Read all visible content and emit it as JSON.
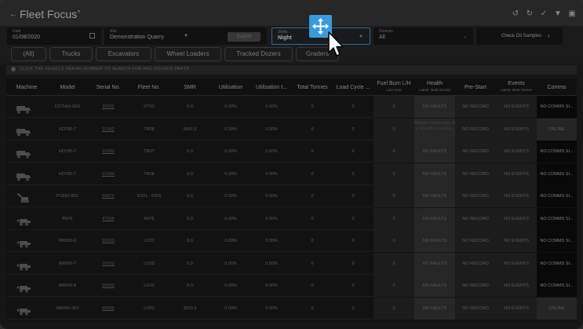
{
  "header": {
    "title": "Fleet Focus"
  },
  "filters": {
    "date": {
      "label": "Date",
      "value": "01/08/2020"
    },
    "site": {
      "label": "Site",
      "value": "Demonstration Quarry"
    },
    "submit_label": "Submit",
    "shifts": {
      "label": "Shifts",
      "value": "Night"
    },
    "devices": {
      "label": "Devices",
      "value": "All"
    },
    "oil_label": "Check Oil Samples"
  },
  "tabs": [
    "(All)",
    "Trucks",
    "Excavators",
    "Wheel Loaders",
    "Tracked Dozers",
    "Graders"
  ],
  "info_text": "CLICK THE VEHICLE SERIAL NUMBER TO SEARCH FOR AND SOURCE PARTS",
  "columns": {
    "machine": "Machine",
    "model": "Model",
    "serial": "Serial No.",
    "fleet": "Fleet No.",
    "smr": "SMR",
    "util": "Utilisation",
    "util_t": "Utilisation t...",
    "tonnes": "Total Tonnes",
    "load": "Load Cycle ...",
    "fuel": "Fuel Burn L/H",
    "fuel_sub": "Last Hour",
    "health": "Health",
    "health_sub": "Latest, Most Severe",
    "prestart": "Pre-Start",
    "events": "Events",
    "events_sub": "Latest, Most Severe",
    "comms": "Comms"
  },
  "rows": [
    {
      "icon": "truck-icon",
      "model": "D275AX-5E0",
      "serial": "32302",
      "fleet": "DT01",
      "smr": "0.0",
      "util": "0.00%",
      "util_t": "0.00%",
      "tonnes": "0",
      "load": "0",
      "fuel": "0",
      "health": "NO FAULTS",
      "prestart": "NO RECORD",
      "events": "NO EVENTS",
      "comms": "NO COMMS SI..."
    },
    {
      "icon": "truck-icon",
      "model": "HD785-7",
      "serial": "32382",
      "fleet": "TR06",
      "smr": "9041.5",
      "util": "0.00%",
      "util_t": "0.00%",
      "tonnes": "0",
      "load": "0",
      "fuel": "0",
      "health": "Altitude Overrange of a Specific Load lvl...",
      "prestart": "NO RECORD",
      "events": "NO EVENTS",
      "comms": "ONLINE"
    },
    {
      "icon": "truck-icon",
      "model": "HD785-7",
      "serial": "32382",
      "fleet": "TR07",
      "smr": "0.0",
      "util": "0.00%",
      "util_t": "0.00%",
      "tonnes": "0",
      "load": "0",
      "fuel": "0",
      "health": "NO FAULTS",
      "prestart": "NO RECORD",
      "events": "NO EVENTS",
      "comms": "NO COMMS SI..."
    },
    {
      "icon": "truck-icon",
      "model": "HD785-7",
      "serial": "32384",
      "fleet": "TR08",
      "smr": "0.0",
      "util": "0.00%",
      "util_t": "0.00%",
      "tonnes": "0",
      "load": "0",
      "fuel": "0",
      "health": "NO FAULTS",
      "prestart": "NO RECORD",
      "events": "NO EVENTS",
      "comms": "NO COMMS SI..."
    },
    {
      "icon": "excavator-icon",
      "model": "PC850-8E0",
      "serial": "60670",
      "fleet": "EX01 - 6306",
      "smr": "0.0",
      "util": "0.00%",
      "util_t": "0.00%",
      "tonnes": "0",
      "load": "0",
      "fuel": "0",
      "health": "NO FAULTS",
      "prestart": "NO RECORD",
      "events": "NO EVENTS",
      "comms": "NO COMMS SI..."
    },
    {
      "icon": "loader-icon",
      "model": "R976",
      "serial": "47568",
      "fleet": "R976",
      "smr": "0.0",
      "util": "0.00%",
      "util_t": "0.00%",
      "tonnes": "0",
      "load": "0",
      "fuel": "0",
      "health": "NO FAULTS",
      "prestart": "NO RECORD",
      "events": "NO EVENTS",
      "comms": "NO COMMS SI..."
    },
    {
      "icon": "loader-icon",
      "model": "WA500-6",
      "serial": "56263",
      "fleet": "LO07",
      "smr": "0.0",
      "util": "0.00%",
      "util_t": "0.00%",
      "tonnes": "0",
      "load": "0",
      "fuel": "0",
      "health": "NO FAULTS",
      "prestart": "NO RECORD",
      "events": "NO EVENTS",
      "comms": "NO COMMS SI..."
    },
    {
      "icon": "loader-icon",
      "model": "WA500-7",
      "serial": "70332",
      "fleet": "LO03",
      "smr": "0.0",
      "util": "0.00%",
      "util_t": "0.00%",
      "tonnes": "0",
      "load": "0",
      "fuel": "0",
      "health": "NO FAULTS",
      "prestart": "NO RECORD",
      "events": "NO EVENTS",
      "comms": "NO COMMS SI..."
    },
    {
      "icon": "loader-icon",
      "model": "WA500-8",
      "serial": "90583",
      "fleet": "LO12",
      "smr": "0.0",
      "util": "0.00%",
      "util_t": "0.00%",
      "tonnes": "0",
      "load": "0",
      "fuel": "0",
      "health": "NO FAULTS",
      "prestart": "NO RECORD",
      "events": "NO EVENTS",
      "comms": "NO COMMS SI..."
    },
    {
      "icon": "loader-icon",
      "model": "WA900-3E0",
      "serial": "60038",
      "fleet": "LO01",
      "smr": "3520.3",
      "util": "0.00%",
      "util_t": "0.00%",
      "tonnes": "0",
      "load": "0",
      "fuel": "0",
      "health": "NO FAULTS",
      "prestart": "NO RECORD",
      "events": "NO EVENTS",
      "comms": "ONLINE"
    }
  ],
  "colors": {
    "accent": "#4aa3df",
    "background": "#222222"
  }
}
